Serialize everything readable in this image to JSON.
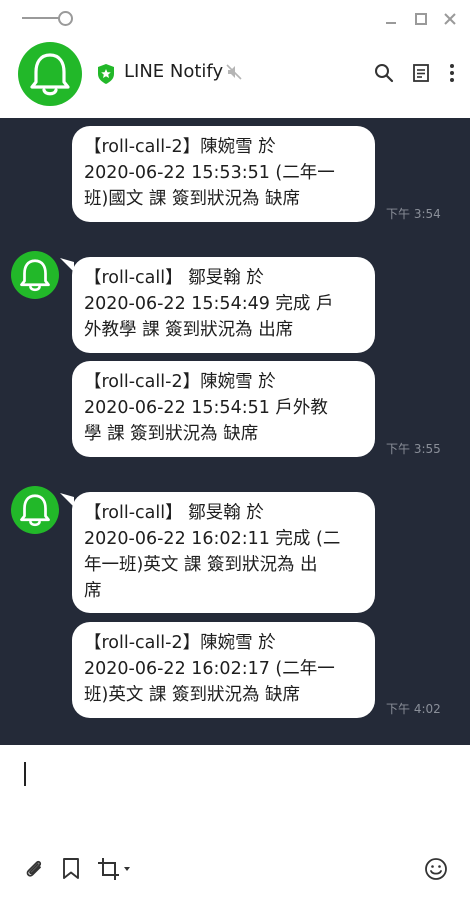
{
  "header": {
    "chat_name": "LINE Notify"
  },
  "messages": [
    {
      "lines": [
        "【roll-call-2】陳婉雪 於",
        "2020-06-22 15:53:51 (二年一",
        "班)國文 課 簽到狀況為 缺席"
      ],
      "time": "下午 3:54"
    },
    {
      "lines": [
        "【roll-call】 鄒旻翰 於",
        "2020-06-22 15:54:49 完成 戶",
        "外教學 課 簽到狀況為 出席"
      ],
      "time": ""
    },
    {
      "lines": [
        "【roll-call-2】陳婉雪 於",
        "2020-06-22 15:54:51 戶外教",
        "學 課 簽到狀況為 缺席"
      ],
      "time": "下午 3:55"
    },
    {
      "lines": [
        "【roll-call】 鄒旻翰 於",
        "2020-06-22 16:02:11 完成 (二",
        "年一班)英文 課 簽到狀況為 出",
        "席"
      ],
      "time": ""
    },
    {
      "lines": [
        "【roll-call-2】陳婉雪 於",
        "2020-06-22 16:02:17 (二年一",
        "班)英文 課 簽到狀況為 缺席"
      ],
      "time": "下午 4:02"
    }
  ],
  "icons": {
    "bot_avatar": "bell-icon",
    "verified": "shield-star-icon",
    "muted": "mute-icon",
    "search": "search-icon",
    "notes": "notes-icon",
    "menu": "more-vertical-icon",
    "attach": "paperclip-icon",
    "bookmark": "bookmark-icon",
    "crop": "crop-icon",
    "emoji": "emoji-icon"
  },
  "colors": {
    "brand_green": "#22b829",
    "chat_background": "#242a38",
    "bubble": "#ffffff"
  }
}
